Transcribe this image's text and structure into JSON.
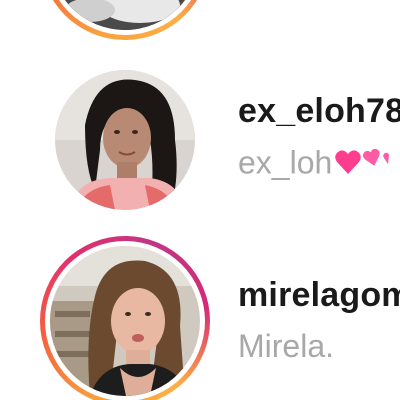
{
  "users": [
    {
      "username": "",
      "fullname": "",
      "has_story": true,
      "avatar_icon": "profile-photo-dark"
    },
    {
      "username": "ex_eloh78",
      "fullname": "ex_loh",
      "fullname_suffix_icon": "pink-hearts-emoji",
      "has_story": false,
      "avatar_icon": "profile-photo-curly-hair"
    },
    {
      "username": "mirelagom",
      "fullname": "Mirela.",
      "has_story": true,
      "avatar_icon": "profile-photo-pout"
    }
  ],
  "colors": {
    "story_ring_gradient": [
      "#f9a03c",
      "#f56040",
      "#e1306c",
      "#c13584"
    ],
    "username": "#1a1a1a",
    "fullname": "#a8a8a8"
  }
}
